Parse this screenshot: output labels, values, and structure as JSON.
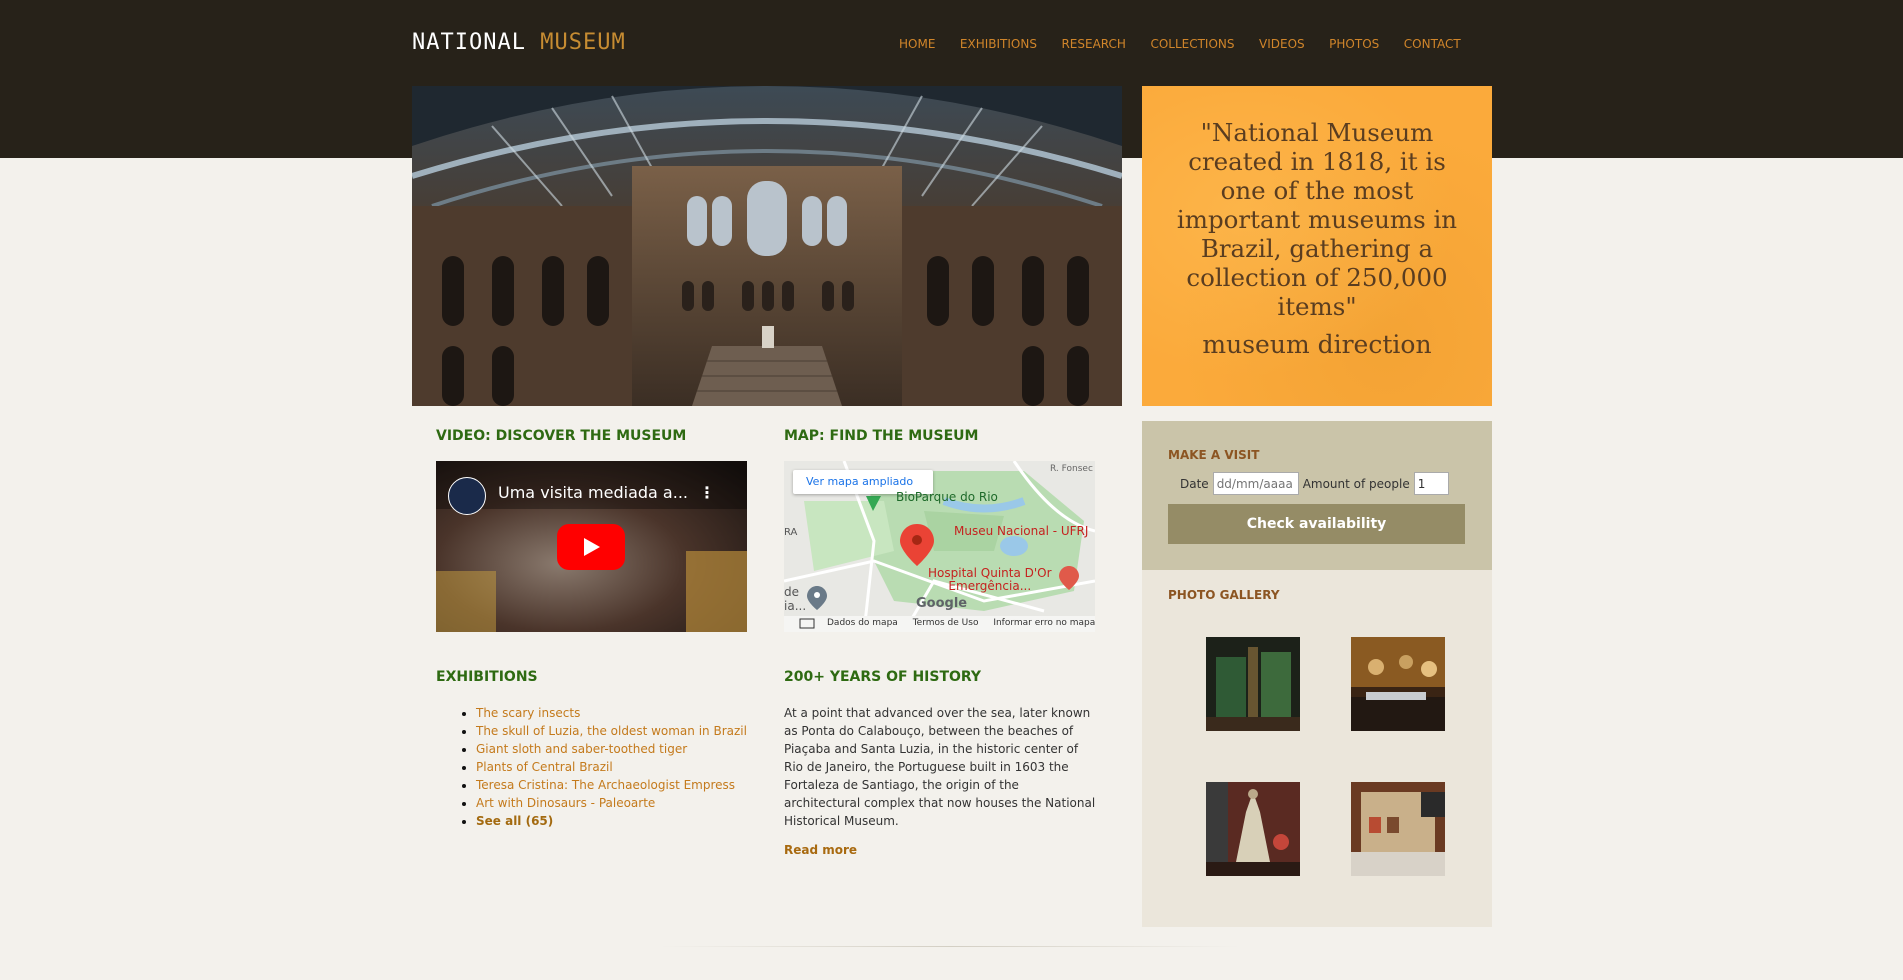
{
  "header": {
    "logo_word1": "NATIONAL",
    "logo_word2": "MUSEUM",
    "nav": [
      "HOME",
      "EXHIBITIONS",
      "RESEARCH",
      "COLLECTIONS",
      "VIDEOS",
      "PHOTOS",
      "CONTACT"
    ]
  },
  "quote": {
    "text": "\"National Museum created in 1818, it is one of the most important museums in Brazil, gathering a collection of 250,000 items\"",
    "signature": "museum direction"
  },
  "visit": {
    "title": "MAKE A VISIT",
    "date_label": "Date",
    "date_placeholder": "dd/mm/aaaa",
    "amount_label": "Amount of people",
    "amount_value": "1",
    "button_label": "Check availability"
  },
  "gallery": {
    "title": "PHOTO GALLERY"
  },
  "video": {
    "section_title": "VIDEO: DISCOVER THE MUSEUM",
    "video_title": "Uma visita mediada a..."
  },
  "map": {
    "section_title": "MAP: FIND THE MUSEUM",
    "open_link": "Ver mapa ampliado",
    "place1": "BioParque do Rio",
    "place2": "Museu Nacional - UFRJ",
    "place3": "Hospital Quinta D'Or",
    "place3b": "Emergência...",
    "edge_left1": "RA",
    "edge_left2": "de",
    "edge_left3": "ia...",
    "edge_top_right": "R. Fonsec",
    "google": "Google",
    "footer1": "Dados do mapa",
    "footer2": "Termos de Uso",
    "footer3": "Informar erro no mapa"
  },
  "exhibitions": {
    "section_title": "EXHIBITIONS",
    "items": [
      "The scary insects",
      "The skull of Luzia, the oldest woman in Brazil",
      "Giant sloth and saber-toothed tiger",
      "Plants of Central Brazil",
      "Teresa Cristina: The Archaeologist Empress",
      "Art with Dinosaurs - Paleoarte"
    ],
    "see_all": "See all (65)"
  },
  "history": {
    "section_title": "200+ YEARS OF HISTORY",
    "text": "At a point that advanced over the sea, later known as Ponta do Calabouço, between the beaches of Piaçaba and Santa Luzia, in the historic center of Rio de Janeiro, the Portuguese built in 1603 the Fortaleza de Santiago, the origin of the architectural complex that now houses the National Historical Museum.",
    "read_more": "Read more"
  },
  "colors": {
    "header_bg": "#272219",
    "accent": "#c68c32",
    "section_title": "#2e6a12",
    "quote_bg": "#fbaa3b",
    "visit_bg": "#cac4a9",
    "button_bg": "#958c66",
    "gallery_bg": "#ebe6db"
  }
}
